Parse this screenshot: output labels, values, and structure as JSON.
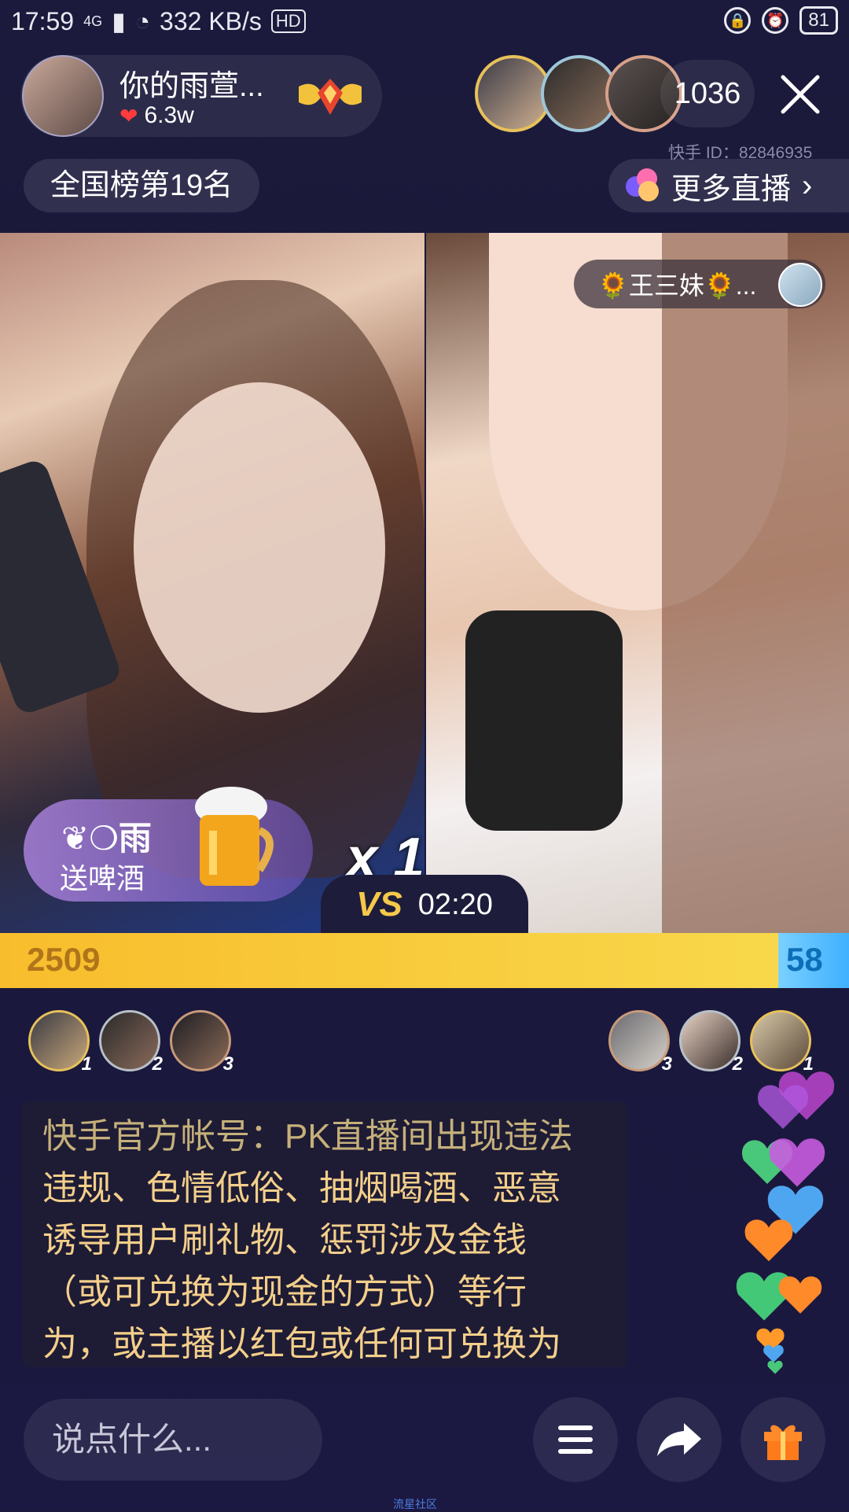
{
  "status_bar": {
    "time": "17:59",
    "network": "4G",
    "speed": "332 KB/s",
    "hd": "HD",
    "battery": "81"
  },
  "host": {
    "name": "你的雨萱...",
    "likes": "6.3w",
    "avatar_icon": "host-avatar"
  },
  "viewers": {
    "count": "1036",
    "kuaishou_id": "快手 ID：82846935"
  },
  "rank": {
    "label": "全国榜第19名"
  },
  "more_live": {
    "label": "更多直播",
    "chevron": "›"
  },
  "opponent": {
    "name": "🌻王三妹🌻..."
  },
  "gift": {
    "user": "❦❍雨",
    "text": "送啤酒",
    "combo": "x 1"
  },
  "pk": {
    "vs": "VS",
    "timer": "02:20",
    "left_score": "2509",
    "right_score": "58",
    "left_fraction": 0.917
  },
  "left_ranks": [
    "1",
    "2",
    "3"
  ],
  "right_ranks": [
    "3",
    "2",
    "1"
  ],
  "notice": {
    "line1": "快手官方帐号：PK直播间出现违法",
    "line2": "违规、色情低俗、抽烟喝酒、恶意",
    "line3": "诱导用户刷礼物、惩罚涉及金钱",
    "line4": "（或可兑换为现金的方式）等行",
    "line5": "为，或主播以红包或任何可兑换为"
  },
  "input": {
    "placeholder": "说点什么..."
  },
  "watermark": "流星社区",
  "colors": {
    "background": "#1b1a3c",
    "pk_left": "#f8c63a",
    "pk_right": "#4bb8ff",
    "notice_text": "#f3cf8a"
  }
}
